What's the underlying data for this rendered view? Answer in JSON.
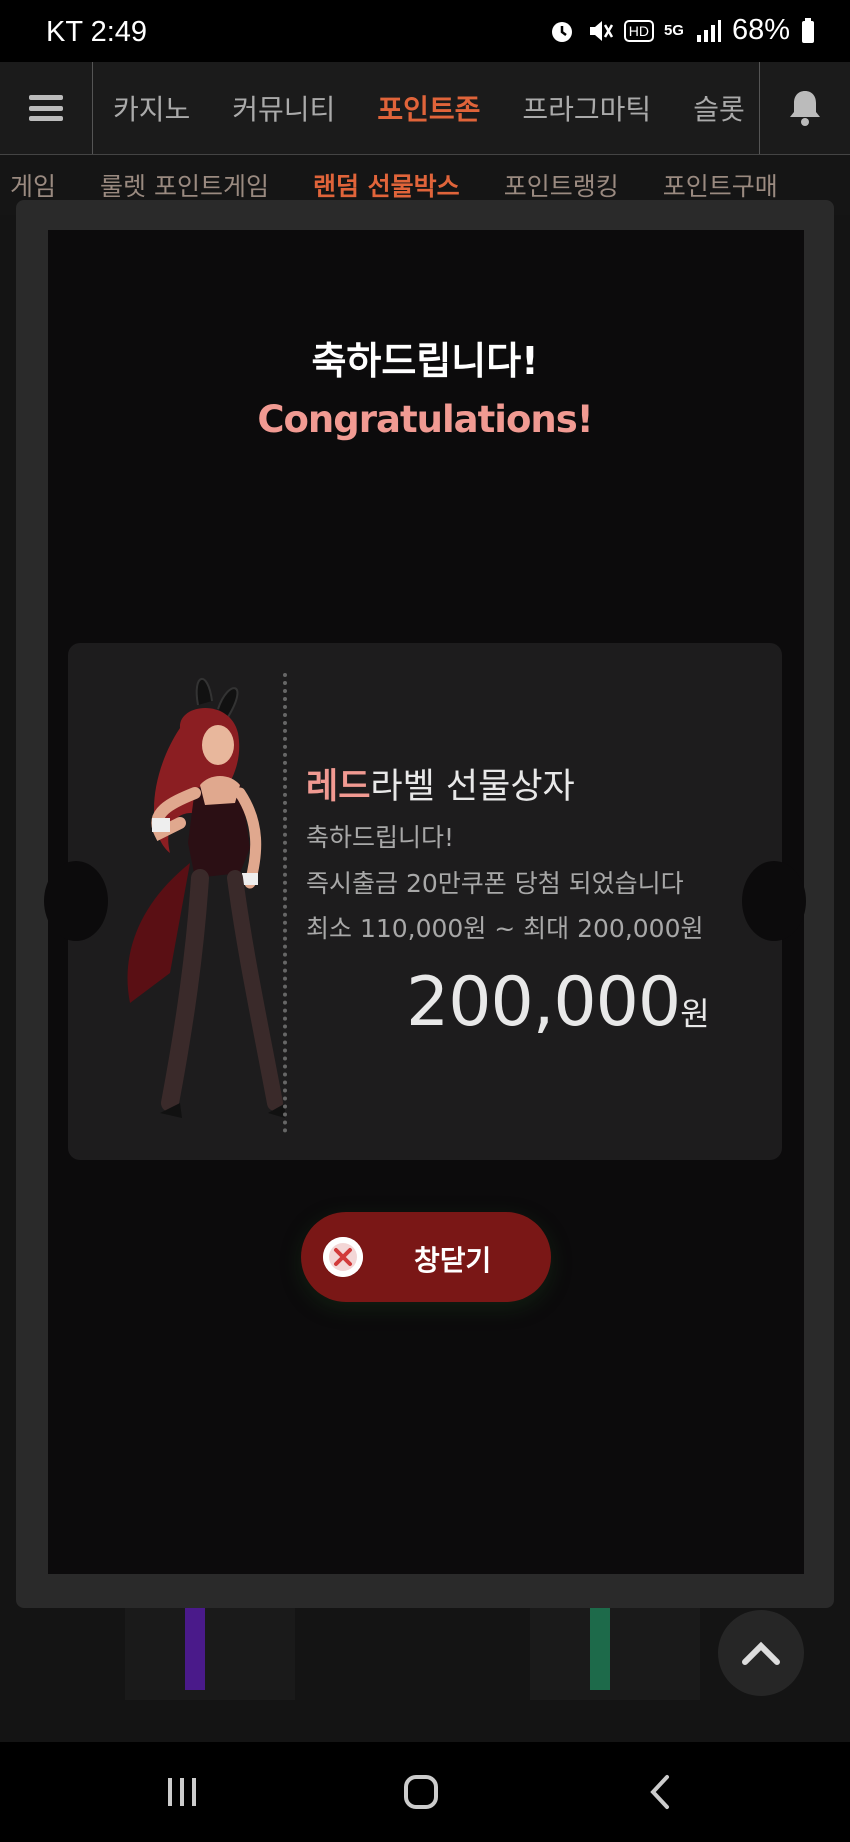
{
  "status_bar": {
    "carrier_time": "KT 2:49",
    "battery": "68%",
    "network_badge": "5G",
    "hd_badge": "HD"
  },
  "top_nav": {
    "items": [
      "카지노",
      "커뮤니티",
      "포인트존",
      "프라그마틱",
      "슬롯"
    ],
    "active": "포인트존"
  },
  "sub_nav": {
    "items": [
      "게임",
      "룰렛 포인트게임",
      "랜덤 선물박스",
      "포인트랭킹",
      "포인트구매"
    ],
    "active": "랜덤 선물박스"
  },
  "modal": {
    "title_ko": "축하드립니다!",
    "title_en": "Congratulations!",
    "prize": {
      "title_highlight": "레드",
      "title_rest": "라벨 선물상자",
      "line1": "축하드립니다!",
      "line2": "즉시출금 20만쿠폰 당첨 되었습니다",
      "line3": "최소 110,000원 ~ 최대 200,000원",
      "amount": "200,000",
      "unit": "원"
    },
    "close_label": "창닫기"
  },
  "colors": {
    "accent": "#e0643a",
    "pink": "#f19a92",
    "close_button": "#7a1716",
    "modal_bg": "#0c0b0c"
  },
  "icons": [
    "menu-icon",
    "bell-icon",
    "close-circle-icon",
    "chevron-up-icon",
    "recent-apps-icon",
    "home-icon",
    "back-icon"
  ]
}
